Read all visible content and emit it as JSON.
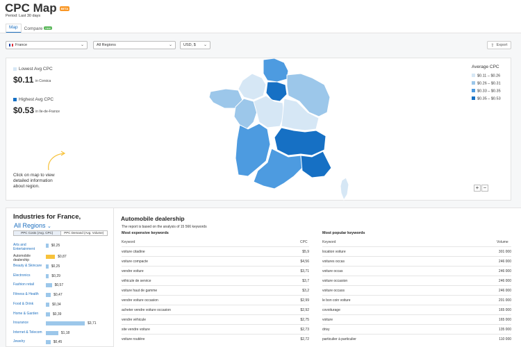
{
  "header": {
    "title": "CPC Map",
    "beta": "BETA",
    "period": "Period: Last 30 days"
  },
  "tabs": [
    {
      "label": "Map"
    },
    {
      "label": "Compare"
    }
  ],
  "tab_new_badge": "new",
  "filters": {
    "country": "France",
    "regions": "All Regions",
    "currency": "USD, $",
    "export_label": "Export"
  },
  "map_panel": {
    "lowest_label": "Lowest Avg CPC",
    "lowest_value": "$0.11",
    "lowest_region": "in Corsica",
    "highest_label": "Highest Avg CPC",
    "highest_value": "$0.53",
    "highest_region": "in Ile-de-France",
    "hint": "Click on map to view detailed information about region.",
    "legend_title": "Average CPC",
    "legend": [
      {
        "label": "$0.11 – $0.26",
        "color": "#d6e7f5"
      },
      {
        "label": "$0.26 – $0.31",
        "color": "#9cc7ea"
      },
      {
        "label": "$0.33 – $0.35",
        "color": "#4d9be0"
      },
      {
        "label": "$0.35 – $0.53",
        "color": "#1670c4"
      }
    ],
    "zoom_in": "+",
    "zoom_out": "−"
  },
  "industries": {
    "title": "Industries for France,",
    "region_link": "All Regions",
    "seg_cpc": "PPC Costs (Avg. CPC)",
    "seg_demand": "PPC Demand (Avg. Volume)",
    "items": [
      {
        "name": "Arts and Entertainment",
        "value": "$0,25",
        "amount": 0.25,
        "selected": false
      },
      {
        "name": "Automobile dealership",
        "value": "$0,87",
        "amount": 0.87,
        "selected": true
      },
      {
        "name": "Beauty & Skincare",
        "value": "$0,25",
        "amount": 0.25,
        "selected": false
      },
      {
        "name": "Electronics",
        "value": "$0,29",
        "amount": 0.29,
        "selected": false
      },
      {
        "name": "Fashion retail",
        "value": "$0,57",
        "amount": 0.57,
        "selected": false
      },
      {
        "name": "Fitness & Health",
        "value": "$0,47",
        "amount": 0.47,
        "selected": false
      },
      {
        "name": "Food & Drink",
        "value": "$0,34",
        "amount": 0.34,
        "selected": false
      },
      {
        "name": "Home & Garden",
        "value": "$0,39",
        "amount": 0.39,
        "selected": false
      },
      {
        "name": "Insurance",
        "value": "$3,71",
        "amount": 3.71,
        "selected": false
      },
      {
        "name": "Internet & Telecom",
        "value": "$1,18",
        "amount": 1.18,
        "selected": false
      },
      {
        "name": "Jewelry",
        "value": "$0,45",
        "amount": 0.45,
        "selected": false
      }
    ]
  },
  "keywords": {
    "title": "Automobile dealership",
    "subtitle": "The report is based on the analysis of 15 566 keywords",
    "expensive": {
      "title": "Most expensive keywords",
      "col_keyword": "Keyword",
      "col_value": "CPC",
      "rows": [
        {
          "k": "voiture citadine",
          "v": "$5,9"
        },
        {
          "k": "voiture compacte",
          "v": "$4,56"
        },
        {
          "k": "vendre voiture",
          "v": "$3,71"
        },
        {
          "k": "véhicule de service",
          "v": "$3,7"
        },
        {
          "k": "voiture haut de gamme",
          "v": "$3,2"
        },
        {
          "k": "vendre voiture occasion",
          "v": "$2,99"
        },
        {
          "k": "acheter vendre voiture occasion",
          "v": "$2,92"
        },
        {
          "k": "vendre véhicule",
          "v": "$2,75"
        },
        {
          "k": "site vendre voiture",
          "v": "$2,73"
        },
        {
          "k": "voiture routière",
          "v": "$2,72"
        }
      ]
    },
    "popular": {
      "title": "Most popular keywords",
      "col_keyword": "Keyword",
      "col_value": "Volume",
      "rows": [
        {
          "k": "location voiture",
          "v": "301 000"
        },
        {
          "k": "voitures occas",
          "v": "246 000"
        },
        {
          "k": "voiture occas",
          "v": "246 000"
        },
        {
          "k": "voiture occasion",
          "v": "246 000"
        },
        {
          "k": "voiture occass",
          "v": "246 000"
        },
        {
          "k": "le bon coin voiture",
          "v": "201 000"
        },
        {
          "k": "covoiturage",
          "v": "165 000"
        },
        {
          "k": "voiture",
          "v": "165 000"
        },
        {
          "k": "drivy",
          "v": "135 000"
        },
        {
          "k": "particulier à particulier",
          "v": "110 000"
        }
      ]
    }
  }
}
